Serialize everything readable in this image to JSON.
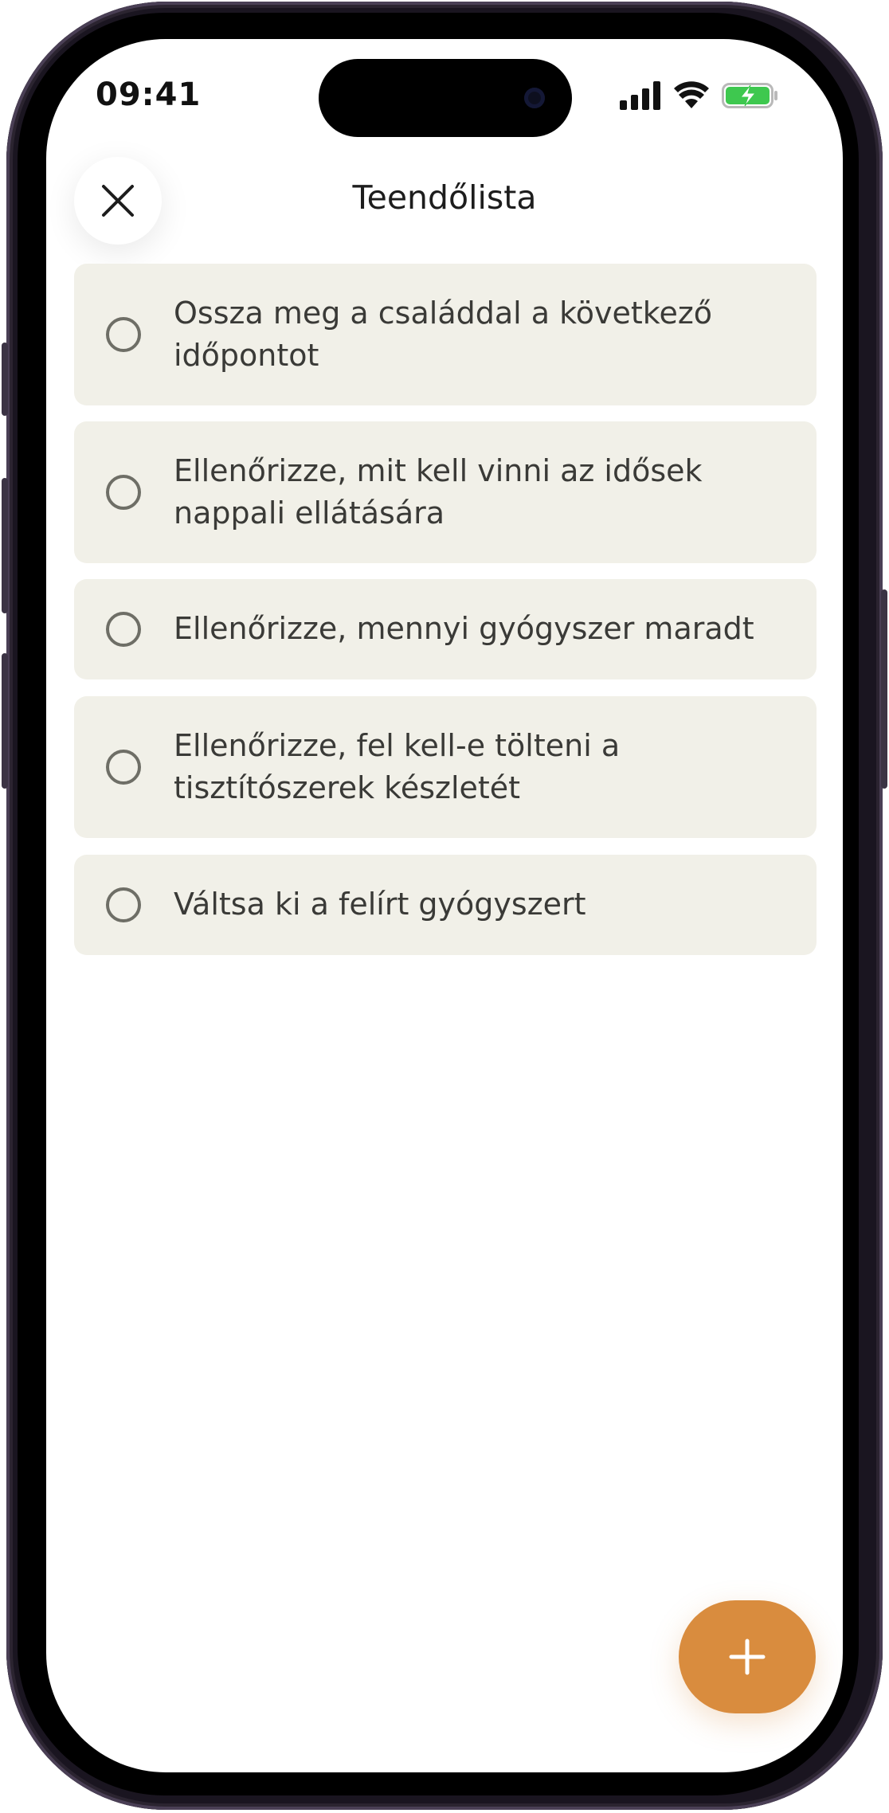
{
  "status_bar": {
    "time": "09:41",
    "icons": [
      "cellular-signal-icon",
      "wifi-icon",
      "battery-charging-icon"
    ],
    "battery_color": "#3ec84f"
  },
  "header": {
    "title": "Teendőlista",
    "close_icon": "close-icon"
  },
  "tasks": [
    {
      "label": "Ossza meg a családdal a következő időpontot",
      "done": false
    },
    {
      "label": "Ellenőrizze, mit kell vinni az idősek nappali ellátására",
      "done": false
    },
    {
      "label": "Ellenőrizze, mennyi gyógyszer maradt",
      "done": false
    },
    {
      "label": "Ellenőrizze, fel kell-e tölteni a tisztítószerek készletét",
      "done": false
    },
    {
      "label": "Váltsa ki a felírt gyógyszert",
      "done": false
    }
  ],
  "fab": {
    "icon": "plus-icon",
    "color": "#d98c3e"
  },
  "theme": {
    "task_background": "#f1f0e8",
    "text_color": "#3a3a37"
  }
}
